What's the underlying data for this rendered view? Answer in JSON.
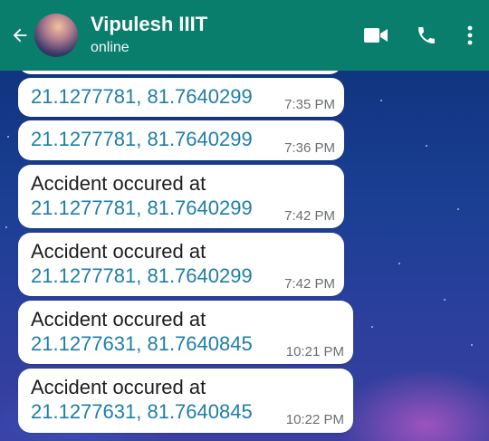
{
  "header": {
    "contact_name": "Vipulesh IIIT",
    "status": "online",
    "back_icon": "arrow-left-icon",
    "video_icon": "video-camera-icon",
    "call_icon": "phone-icon",
    "menu_icon": "more-vertical-icon"
  },
  "colors": {
    "header": "#0a7e6d",
    "link": "#1e7ea8",
    "time": "#6b6f72"
  },
  "messages": [
    {
      "text": "",
      "lat": "21.1277781",
      "lng": "81.7640299",
      "time": "7:35 PM"
    },
    {
      "text": "",
      "lat": "21.1277781",
      "lng": "81.7640299",
      "time": "7:36 PM"
    },
    {
      "text": "Accident occured at",
      "lat": "21.1277781",
      "lng": "81.7640299",
      "time": "7:42 PM"
    },
    {
      "text": "Accident occured at",
      "lat": "21.1277781",
      "lng": "81.7640299",
      "time": "7:42 PM"
    },
    {
      "text": "Accident occured at",
      "lat": "21.1277631",
      "lng": "81.7640845",
      "time": "10:21 PM"
    },
    {
      "text": "Accident occured at",
      "lat": "21.1277631",
      "lng": "81.7640845",
      "time": "10:22 PM"
    }
  ],
  "separator": ", "
}
